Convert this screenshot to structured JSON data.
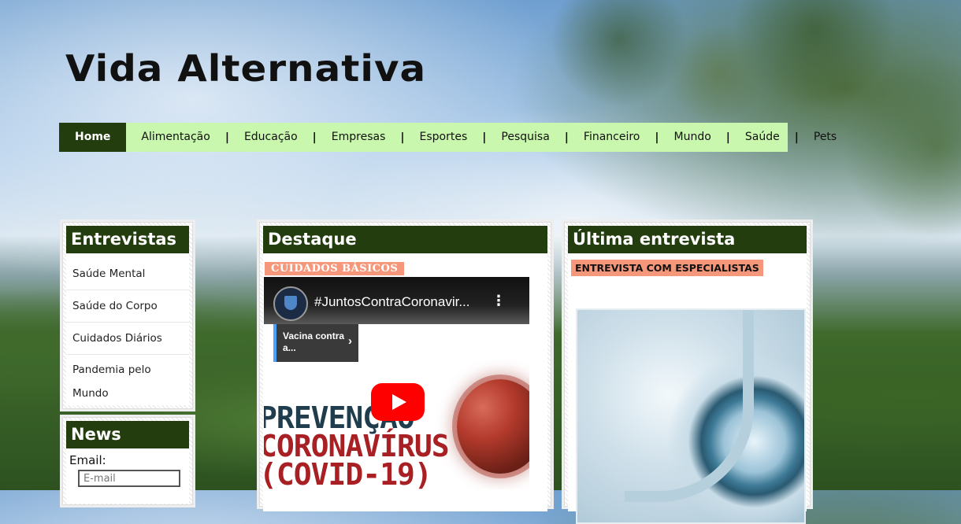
{
  "site": {
    "title": "Vida Alternativa"
  },
  "nav": {
    "items": [
      {
        "label": "Home",
        "active": true
      },
      {
        "label": "Alimentação"
      },
      {
        "label": "Educação"
      },
      {
        "label": "Empresas"
      },
      {
        "label": "Esportes"
      },
      {
        "label": "Pesquisa"
      },
      {
        "label": "Financeiro"
      },
      {
        "label": "Mundo"
      },
      {
        "label": "Saúde"
      },
      {
        "label": "Pets"
      }
    ],
    "separator": "|"
  },
  "entrevistas": {
    "title": "Entrevistas",
    "links": [
      "Saúde Mental",
      "Saúde do Corpo",
      "Cuidados Diários",
      "Pandemia pelo Mundo"
    ]
  },
  "news": {
    "title": "News",
    "email_label": "Email:",
    "email_placeholder": "E-mail"
  },
  "destaque": {
    "title": "Destaque",
    "tag": "CUIDADOS BÁSICOS",
    "video": {
      "title": "#JuntosContraCoronavir...",
      "menu": "⋮",
      "card_text": "Vacina contra a...",
      "card_chevron": "›",
      "lines": [
        "PREVENÇÃO",
        "CORONAVÍRUS",
        "(COVID-19)"
      ]
    }
  },
  "ultima": {
    "title": "Última entrevista",
    "tag": "ENTREVISTA COM ESPECIALISTAS"
  },
  "colors": {
    "header_bg": "#233d0f",
    "nav_bg": "#c9f7ad",
    "tag_bg": "#f4977a",
    "play": "#ff0000"
  }
}
